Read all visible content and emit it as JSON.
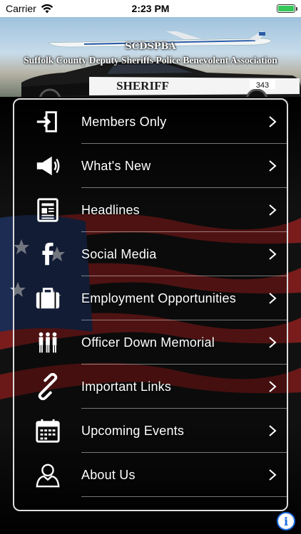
{
  "status_bar": {
    "carrier": "Carrier",
    "time": "2:23 PM"
  },
  "banner": {
    "title": "SCDSPBA",
    "subtitle": "Suffolk County Deputy Sheriffs Police Benevolent Association",
    "car_text": "SHERIFF",
    "car_number": "343"
  },
  "menu": {
    "items": [
      {
        "label": "Members Only",
        "icon": "enter-door-icon"
      },
      {
        "label": "What's New",
        "icon": "megaphone-icon"
      },
      {
        "label": "Headlines",
        "icon": "newspaper-icon"
      },
      {
        "label": "Social Media",
        "icon": "facebook-icon"
      },
      {
        "label": "Employment Opportunities",
        "icon": "briefcase-icon"
      },
      {
        "label": "Officer Down Memorial",
        "icon": "officers-icon"
      },
      {
        "label": "Important Links",
        "icon": "link-icon"
      },
      {
        "label": "Upcoming Events",
        "icon": "calendar-icon"
      },
      {
        "label": "About Us",
        "icon": "person-icon"
      }
    ]
  },
  "colors": {
    "accent": "#1c6ce0",
    "battery": "#34c759"
  }
}
